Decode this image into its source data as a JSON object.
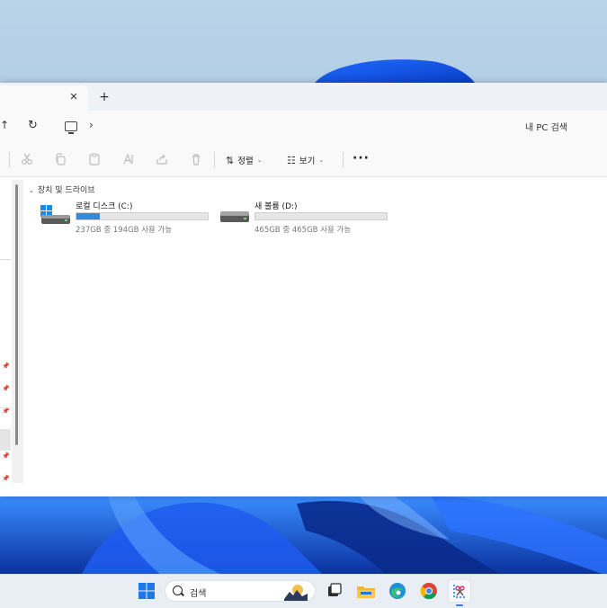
{
  "window": {
    "tab_close_glyph": "✕",
    "tab_add_glyph": "+"
  },
  "addressbar": {
    "up_glyph": "↑",
    "refresh_glyph": "↻",
    "chevron_glyph": "›",
    "search_placeholder": "내 PC 검색"
  },
  "commandbar": {
    "sort_label": "정렬",
    "view_label": "보기",
    "more_label": "···"
  },
  "content": {
    "group_header": "장치 및 드라이브",
    "drives": [
      {
        "name": "로컬 디스크 (C:)",
        "free_text": "237GB 중 194GB 사용 가능",
        "used_fraction": 0.18,
        "icon": "windows-drive-icon"
      },
      {
        "name": "새 볼륨 (D:)",
        "free_text": "465GB 중 465GB 사용 가능",
        "used_fraction": 0.0,
        "icon": "drive-icon"
      }
    ]
  },
  "taskbar": {
    "search_label": "검색",
    "apps": [
      "start-icon",
      "search",
      "task-view-icon",
      "file-explorer-icon",
      "edge-icon",
      "chrome-icon",
      "snipping-tool-icon"
    ]
  },
  "colors": {
    "accent": "#2f8be0",
    "window_bg": "#ffffff",
    "toolbar_bg": "#f9f9f9",
    "taskbar_bg": "#e9eef5"
  }
}
